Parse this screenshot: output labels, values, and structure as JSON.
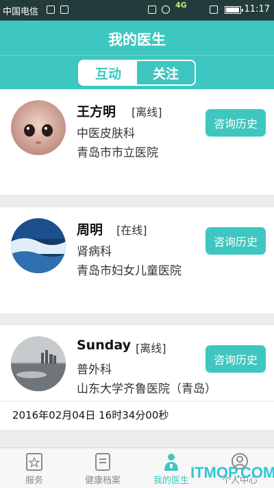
{
  "status_bar": {
    "carrier": "中国电信",
    "network": "4G",
    "time": "11:17"
  },
  "header": {
    "title": "我的医生",
    "tabs": [
      {
        "label": "互动",
        "active": true
      },
      {
        "label": "关注",
        "active": false
      }
    ]
  },
  "doctors": [
    {
      "name": "王方明",
      "status": "[离线]",
      "department": "中医皮肤科",
      "hospital": "青岛市市立医院",
      "consult_label": "咨询历史",
      "avatar": "doll-face-photo"
    },
    {
      "name": "周明",
      "status": "[在线]",
      "department": "肾病科",
      "hospital": "青岛市妇女儿童医院",
      "consult_label": "咨询历史",
      "avatar": "ocean-wave-photo"
    },
    {
      "name": "Sunday",
      "status": "[离线]",
      "department": "普外科",
      "hospital": "山东大学齐鲁医院（青岛）",
      "consult_label": "咨询历史",
      "avatar": "sea-skyline-photo",
      "timestamp": "2016年02月04日 16时34分00秒"
    }
  ],
  "tabbar": {
    "items": [
      {
        "label": "服务",
        "icon": "star-page-icon",
        "active": false
      },
      {
        "label": "健康档案",
        "icon": "record-book-icon",
        "active": false
      },
      {
        "label": "我的医生",
        "icon": "doctor-icon",
        "active": true
      },
      {
        "label": "个人中心",
        "icon": "person-icon",
        "active": false
      }
    ]
  },
  "watermark": "ITMOP.COM",
  "colors": {
    "accent": "#3ec7c0",
    "status_bar": "#233c3b"
  }
}
